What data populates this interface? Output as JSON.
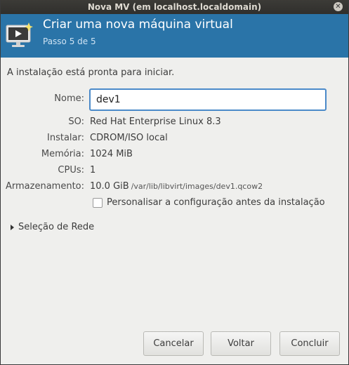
{
  "window": {
    "title": "Nova MV (em localhost.localdomain)"
  },
  "header": {
    "title": "Criar uma nova máquina virtual",
    "step": "Passo 5 de 5",
    "icon": "monitor-play-icon"
  },
  "ready_text": "A instalação está pronta para iniciar.",
  "form": {
    "name_label": "Nome:",
    "name_value": "dev1",
    "os_label": "SO:",
    "os_value": "Red Hat Enterprise Linux 8.3",
    "install_label": "Instalar:",
    "install_value": "CDROM/ISO local",
    "memory_label": "Memória:",
    "memory_value": "1024 MiB",
    "cpus_label": "CPUs:",
    "cpus_value": "1",
    "storage_label": "Armazenamento:",
    "storage_value": "10.0 GiB",
    "storage_path": "/var/lib/libvirt/images/dev1.qcow2",
    "customize_label": "Personalisar a configuração antes da instalação",
    "customize_checked": false
  },
  "network_expander": "Seleção de Rede",
  "buttons": {
    "cancel": "Cancelar",
    "back": "Voltar",
    "finish": "Concluir"
  },
  "colors": {
    "header_bg": "#2a74a8",
    "focus_border": "#4b8ac9"
  }
}
